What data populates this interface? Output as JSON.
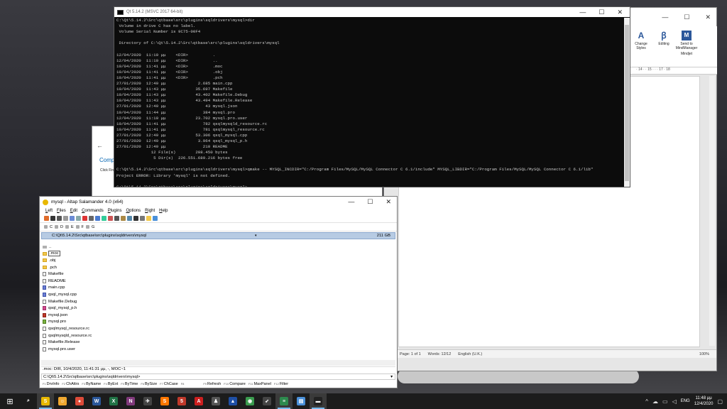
{
  "word": {
    "ribbon": [
      {
        "label": "Change Styles",
        "icon": "change-styles-icon",
        "glyph": "A"
      },
      {
        "label": "Editing",
        "icon": "editing-icon",
        "glyph": "ꞵ"
      },
      {
        "label": "Send to MindManager",
        "icon": "mindmanager-icon",
        "glyph": "M"
      }
    ],
    "ribbon_group": "Mindjet",
    "ruler": "· 14 · · 15 · · · 17 · 18",
    "status_page": "Page: 1 of 1",
    "status_words": "Words: 12/12",
    "status_lang": "English (U.K.)",
    "zoom": "100%"
  },
  "dialog": {
    "back": "←",
    "heading": "Comp",
    "text": "Click Fin"
  },
  "cmd": {
    "title": "Qt 5.14.2 (MSVC 2017 64-bit)",
    "lines": [
      "C:\\Qt\\5.14.2\\Src\\qtbase\\src\\plugins\\sqldrivers\\mysql>dir",
      " Volume in drive C has no label.",
      " Volume Serial Number is 9C75-00F4",
      "",
      " Directory of C:\\Qt\\5.14.2\\Src\\qtbase\\src\\plugins\\sqldrivers\\mysql",
      "",
      "12/04/2020  11:10 μμ    <DIR>          .",
      "12/04/2020  11:10 μμ    <DIR>          ..",
      "10/04/2020  11:41 μμ    <DIR>          .moc",
      "10/04/2020  11:41 μμ    <DIR>          .obj",
      "10/04/2020  11:41 μμ    <DIR>          .pch",
      "27/01/2020  12:49 μμ             2.685 main.cpp",
      "10/04/2020  11:43 μμ            35.697 Makefile",
      "10/04/2020  11:43 μμ            43.402 Makefile.Debug",
      "10/04/2020  11:43 μμ            43.494 Makefile.Release",
      "27/01/2020  12:49 μμ                43 mysql.json",
      "10/04/2020  11:44 μμ               384 mysql.pro",
      "12/04/2020  11:10 μμ            23.702 mysql.pro.user",
      "10/04/2020  11:41 μμ               782 qsqlmysqld_resource.rc",
      "10/04/2020  11:41 μμ               781 qsqlmysql_resource.rc",
      "27/01/2020  12:49 μμ            53.306 qsql_mysql.cpp",
      "27/01/2020  12:49 μμ             3.964 qsql_mysql_p.h",
      "27/01/2020  12:49 μμ               210 README",
      "              12 File(s)        208.450 bytes",
      "               5 Dir(s)  226.551.689.216 bytes free",
      "",
      "C:\\Qt\\5.14.2\\Src\\qtbase\\src\\plugins\\sqldrivers\\mysql>qmake -- MYSQL_INCDIR=\"C:/Program Files/MySQL/MySQL Connector C 6.1/include\" MYSQL_LIBDIR=\"C:/Program Files/MySQL/MySQL Connector C 6.1/lib\"",
      "Project ERROR: Library 'mysql' is not defined.",
      "",
      "C:\\Qt\\5.14.2\\Src\\qtbase\\src\\plugins\\sqldrivers\\mysql>"
    ]
  },
  "salamander": {
    "title": "mysql - Altap Salamander 4.0 (x64)",
    "menu": [
      "Left",
      "Files",
      "Edit",
      "Commands",
      "Plugins",
      "Options",
      "Right",
      "Help"
    ],
    "drives": [
      "C",
      "D",
      "E",
      "F",
      "G"
    ],
    "path": "C:\\Qt\\5.14.2\\Src\\qtbase\\src\\plugins\\sqldrivers\\mysql",
    "dropdown": "▾",
    "free_space": "211 GB",
    "files": [
      {
        "name": "..",
        "type": "up"
      },
      {
        "name": ".moc",
        "type": "dir",
        "selected": true
      },
      {
        "name": ".obj",
        "type": "dir"
      },
      {
        "name": ".pch",
        "type": "dir"
      },
      {
        "name": "Makefile",
        "type": "file"
      },
      {
        "name": "README",
        "type": "file"
      },
      {
        "name": "main.cpp",
        "type": "cpp"
      },
      {
        "name": "qsql_mysql.cpp",
        "type": "cpp"
      },
      {
        "name": "Makefile.Debug",
        "type": "file"
      },
      {
        "name": "qsql_mysql_p.h",
        "type": "hdr"
      },
      {
        "name": "mysql.json",
        "type": "json"
      },
      {
        "name": "mysql.pro",
        "type": "pro"
      },
      {
        "name": "qsqlmysql_resource.rc",
        "type": "file"
      },
      {
        "name": "qsqlmysqld_resource.rc",
        "type": "file"
      },
      {
        "name": "Makefile.Release",
        "type": "file"
      },
      {
        "name": "mysql.pro.user",
        "type": "file"
      }
    ],
    "info": ".moc: DIR, 10/4/2020, 11:41:31 μμ, -, MOC~1",
    "cmdline": "C:\\Qt\\5.14.2\\Src\\qtbase\\src\\plugins\\sqldrivers\\mysql>",
    "fkeys": [
      {
        "key": "F1",
        "label": "DrvInfo"
      },
      {
        "key": "F2",
        "label": "ChAttrs"
      },
      {
        "key": "F3",
        "label": "ByName"
      },
      {
        "key": "F4",
        "label": "ByExt"
      },
      {
        "key": "F5",
        "label": "ByTime"
      },
      {
        "key": "F6",
        "label": "BySize"
      },
      {
        "key": "F7",
        "label": "ChCase"
      },
      {
        "key": "F8",
        "label": ""
      },
      {
        "key": "F9",
        "label": "Refresh"
      },
      {
        "key": "F10",
        "label": "Compare"
      },
      {
        "key": "F11",
        "label": "MaxPanel"
      },
      {
        "key": "F12",
        "label": "Filter"
      }
    ]
  },
  "taskbar": {
    "apps": [
      {
        "name": "search",
        "glyph": "⌕",
        "color": "#1c1c1c"
      },
      {
        "name": "salamander",
        "glyph": "S",
        "color": "#e8b800"
      },
      {
        "name": "app-yellow",
        "glyph": "☺",
        "color": "#f0a830"
      },
      {
        "name": "chrome",
        "glyph": "●",
        "color": "#dd4b39"
      },
      {
        "name": "word",
        "glyph": "W",
        "color": "#2b579a"
      },
      {
        "name": "excel",
        "glyph": "X",
        "color": "#217346"
      },
      {
        "name": "onenote",
        "glyph": "N",
        "color": "#80397b"
      },
      {
        "name": "plane",
        "glyph": "✈",
        "color": "#444"
      },
      {
        "name": "sublime",
        "glyph": "S",
        "color": "#ff7700"
      },
      {
        "name": "app-red",
        "glyph": "5",
        "color": "#c0392b"
      },
      {
        "name": "acrobat",
        "glyph": "A",
        "color": "#cc1f1f"
      },
      {
        "name": "app-shoe",
        "glyph": "♟",
        "color": "#555"
      },
      {
        "name": "app-blue",
        "glyph": "▲",
        "color": "#1f4fa5"
      },
      {
        "name": "app-circle",
        "glyph": "◉",
        "color": "#3a9b4e"
      },
      {
        "name": "app-rocket",
        "glyph": "➶",
        "color": "#444"
      },
      {
        "name": "notepad",
        "glyph": "≡",
        "color": "#2d8a4e"
      },
      {
        "name": "app-doc",
        "glyph": "▤",
        "color": "#4a90d9"
      },
      {
        "name": "console",
        "glyph": "▬",
        "color": "#222"
      }
    ],
    "tray_lang": "ENG",
    "time": "11:48 μμ",
    "date": "12/4/2020"
  }
}
